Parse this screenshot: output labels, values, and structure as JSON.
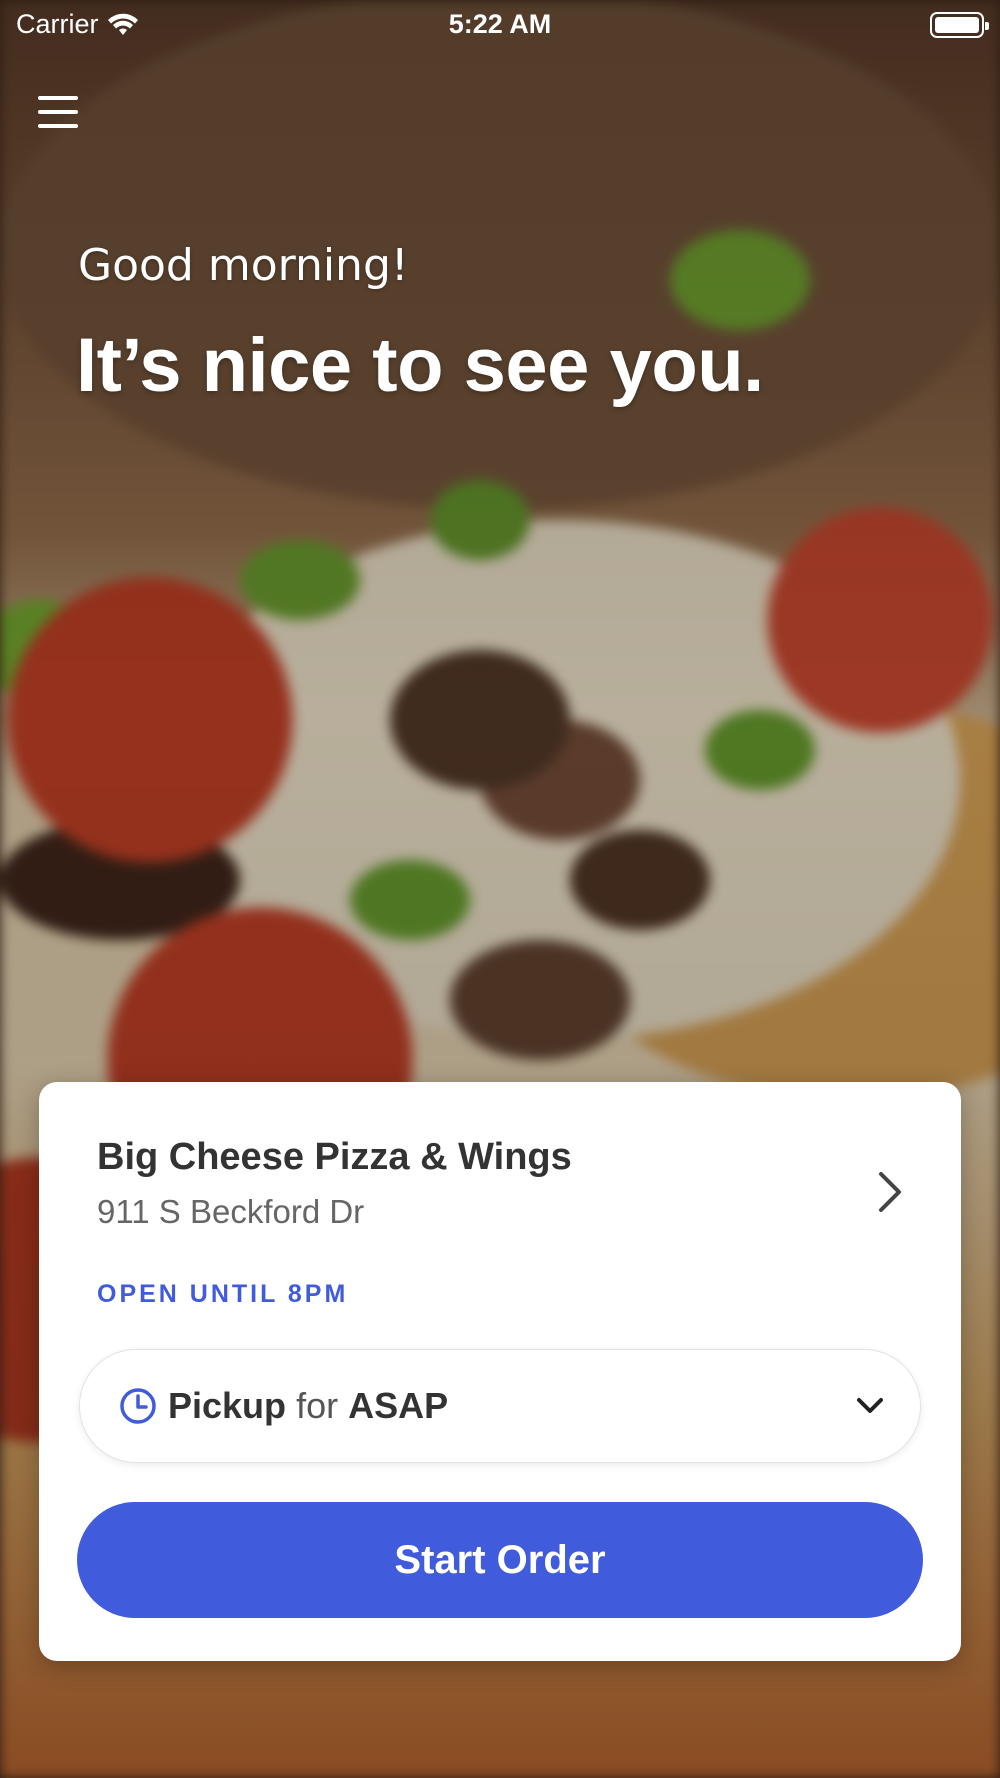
{
  "status_bar": {
    "carrier": "Carrier",
    "time": "5:22 AM",
    "wifi_icon": "wifi-icon",
    "battery_icon": "battery-full-icon",
    "battery_level": 1.0
  },
  "header": {
    "menu_icon": "hamburger-menu-icon",
    "greeting": "Good morning!",
    "headline": "It’s nice to see you."
  },
  "store_card": {
    "name": "Big Cheese Pizza & Wings",
    "address": "911 S Beckford Dr",
    "hours": "OPEN UNTIL 8PM",
    "chevron_icon": "chevron-right-icon"
  },
  "order_mode": {
    "icon": "clock-icon",
    "mode": "Pickup",
    "connector": "for",
    "time": "ASAP",
    "dropdown_icon": "chevron-down-icon"
  },
  "cta": {
    "label": "Start Order"
  },
  "colors": {
    "accent": "#405bdc",
    "card_background": "#ffffff",
    "text_primary": "#333333",
    "text_secondary": "#666666"
  }
}
